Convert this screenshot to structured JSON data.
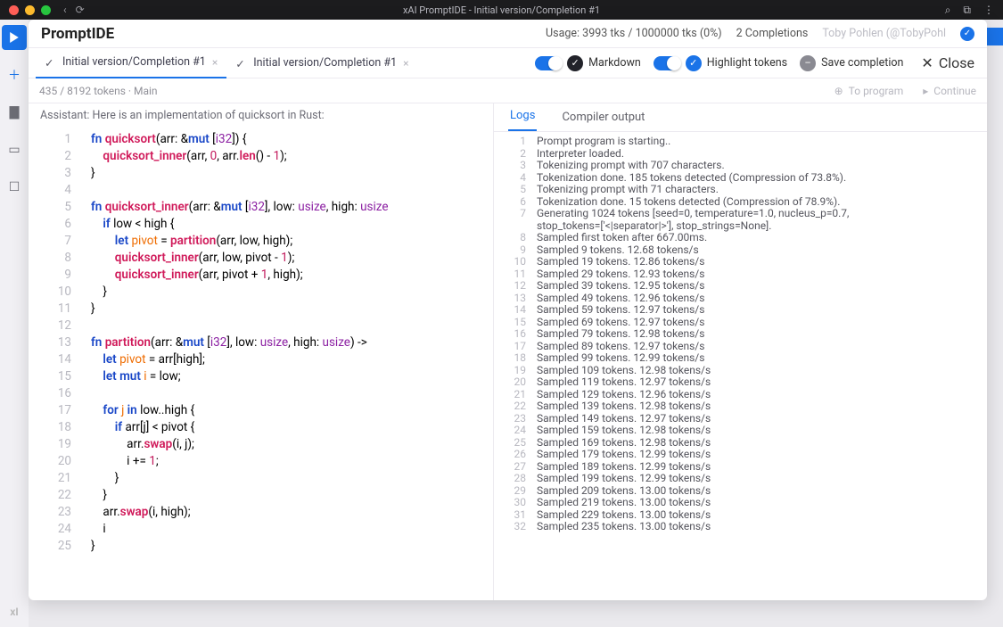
{
  "titlebar": {
    "title": "xAI PromptIDE - Initial version/Completion #1"
  },
  "rail": {
    "foot": "xI"
  },
  "header": {
    "app_title": "PromptIDE",
    "usage": "Usage: 3993 tks / 1000000 tks (0%)",
    "completions": "2 Completions",
    "user_name": "Toby Pohlen",
    "user_handle": "(@TobyPohl"
  },
  "file_tabs": {
    "t1": "Initial version/Completion #1",
    "t2": "Initial version/Completion #1"
  },
  "toggles": {
    "markdown": "Markdown",
    "highlight": "Highlight tokens",
    "save": "Save completion",
    "close": "Close"
  },
  "subrow": {
    "tokens": "435 / 8192 tokens · Main",
    "to_program": "To program",
    "continue": "Continue"
  },
  "editor": {
    "assistant_line": "Assistant: Here is an implementation of quicksort in Rust:"
  },
  "code": [
    {
      "n": 1,
      "html": "<span class='kw'>fn</span> <span class='fn'>quicksort</span>(arr: &<span class='kw'>mut</span> [<span class='ty'>i32</span>]) {"
    },
    {
      "n": 2,
      "html": "    <span class='fn'>quicksort_inner</span>(arr, <span class='num'>0</span>, arr.<span class='fn'>len</span>() - <span class='num'>1</span>);"
    },
    {
      "n": 3,
      "html": "}"
    },
    {
      "n": 4,
      "html": ""
    },
    {
      "n": 5,
      "html": "<span class='kw'>fn</span> <span class='fn'>quicksort_inner</span>(arr: &<span class='kw'>mut</span> [<span class='ty'>i32</span>], low: <span class='ty'>usize</span>, high: <span class='ty'>usize</span>"
    },
    {
      "n": 6,
      "html": "    <span class='kw'>if</span> low &lt; high {"
    },
    {
      "n": 7,
      "html": "        <span class='kw'>let</span> <span class='id'>pivot</span> = <span class='fn'>partition</span>(arr, low, high);"
    },
    {
      "n": 8,
      "html": "        <span class='fn'>quicksort_inner</span>(arr, low, pivot - <span class='num'>1</span>);"
    },
    {
      "n": 9,
      "html": "        <span class='fn'>quicksort_inner</span>(arr, pivot + <span class='num'>1</span>, high);"
    },
    {
      "n": 10,
      "html": "    }"
    },
    {
      "n": 11,
      "html": "}"
    },
    {
      "n": 12,
      "html": ""
    },
    {
      "n": 13,
      "html": "<span class='kw'>fn</span> <span class='fn'>partition</span>(arr: &<span class='kw'>mut</span> [<span class='ty'>i32</span>], low: <span class='ty'>usize</span>, high: <span class='ty'>usize</span>) -&gt; "
    },
    {
      "n": 14,
      "html": "    <span class='kw'>let</span> <span class='id'>pivot</span> = arr[high];"
    },
    {
      "n": 15,
      "html": "    <span class='kw'>let mut</span> <span class='id'>i</span> = low;"
    },
    {
      "n": 16,
      "html": ""
    },
    {
      "n": 17,
      "html": "    <span class='kw'>for</span> <span class='id'>j</span> <span class='kw'>in</span> low..high {"
    },
    {
      "n": 18,
      "html": "        <span class='kw'>if</span> arr[j] &lt; pivot {"
    },
    {
      "n": 19,
      "html": "            arr.<span class='fn'>swap</span>(i, j);"
    },
    {
      "n": 20,
      "html": "            i += <span class='num'>1</span>;"
    },
    {
      "n": 21,
      "html": "        }"
    },
    {
      "n": 22,
      "html": "    }"
    },
    {
      "n": 23,
      "html": "    arr.<span class='fn'>swap</span>(i, high);"
    },
    {
      "n": 24,
      "html": "    i"
    },
    {
      "n": 25,
      "html": "}"
    }
  ],
  "log_tabs": {
    "logs": "Logs",
    "compiler": "Compiler output"
  },
  "logs": [
    {
      "n": 1,
      "t": "Prompt program is starting.."
    },
    {
      "n": 2,
      "t": "Interpreter loaded."
    },
    {
      "n": 3,
      "t": "Tokenizing prompt with 707 characters."
    },
    {
      "n": 4,
      "t": "Tokenization done. 185 tokens detected (Compression of 73.8%)."
    },
    {
      "n": 5,
      "t": "Tokenizing prompt with 71 characters."
    },
    {
      "n": 6,
      "t": "Tokenization done. 15 tokens detected (Compression of 78.9%)."
    },
    {
      "n": 7,
      "t": "Generating 1024 tokens [seed=0, temperature=1.0, nucleus_p=0.7,\nstop_tokens=['<|separator|>'], stop_strings=None]."
    },
    {
      "n": 8,
      "t": "Sampled first token after 667.00ms."
    },
    {
      "n": 9,
      "t": "Sampled 9 tokens. 12.68 tokens/s"
    },
    {
      "n": 10,
      "t": "Sampled 19 tokens. 12.86 tokens/s"
    },
    {
      "n": 11,
      "t": "Sampled 29 tokens. 12.93 tokens/s"
    },
    {
      "n": 12,
      "t": "Sampled 39 tokens. 12.95 tokens/s"
    },
    {
      "n": 13,
      "t": "Sampled 49 tokens. 12.96 tokens/s"
    },
    {
      "n": 14,
      "t": "Sampled 59 tokens. 12.97 tokens/s"
    },
    {
      "n": 15,
      "t": "Sampled 69 tokens. 12.97 tokens/s"
    },
    {
      "n": 16,
      "t": "Sampled 79 tokens. 12.98 tokens/s"
    },
    {
      "n": 17,
      "t": "Sampled 89 tokens. 12.97 tokens/s"
    },
    {
      "n": 18,
      "t": "Sampled 99 tokens. 12.99 tokens/s"
    },
    {
      "n": 19,
      "t": "Sampled 109 tokens. 12.98 tokens/s"
    },
    {
      "n": 20,
      "t": "Sampled 119 tokens. 12.97 tokens/s"
    },
    {
      "n": 21,
      "t": "Sampled 129 tokens. 12.96 tokens/s"
    },
    {
      "n": 22,
      "t": "Sampled 139 tokens. 12.98 tokens/s"
    },
    {
      "n": 23,
      "t": "Sampled 149 tokens. 12.97 tokens/s"
    },
    {
      "n": 24,
      "t": "Sampled 159 tokens. 12.98 tokens/s"
    },
    {
      "n": 25,
      "t": "Sampled 169 tokens. 12.98 tokens/s"
    },
    {
      "n": 26,
      "t": "Sampled 179 tokens. 12.99 tokens/s"
    },
    {
      "n": 27,
      "t": "Sampled 189 tokens. 12.99 tokens/s"
    },
    {
      "n": 28,
      "t": "Sampled 199 tokens. 12.99 tokens/s"
    },
    {
      "n": 29,
      "t": "Sampled 209 tokens. 13.00 tokens/s"
    },
    {
      "n": 30,
      "t": "Sampled 219 tokens. 13.00 tokens/s"
    },
    {
      "n": 31,
      "t": "Sampled 229 tokens. 13.00 tokens/s"
    },
    {
      "n": 32,
      "t": "Sampled 235 tokens. 13.00 tokens/s"
    }
  ]
}
